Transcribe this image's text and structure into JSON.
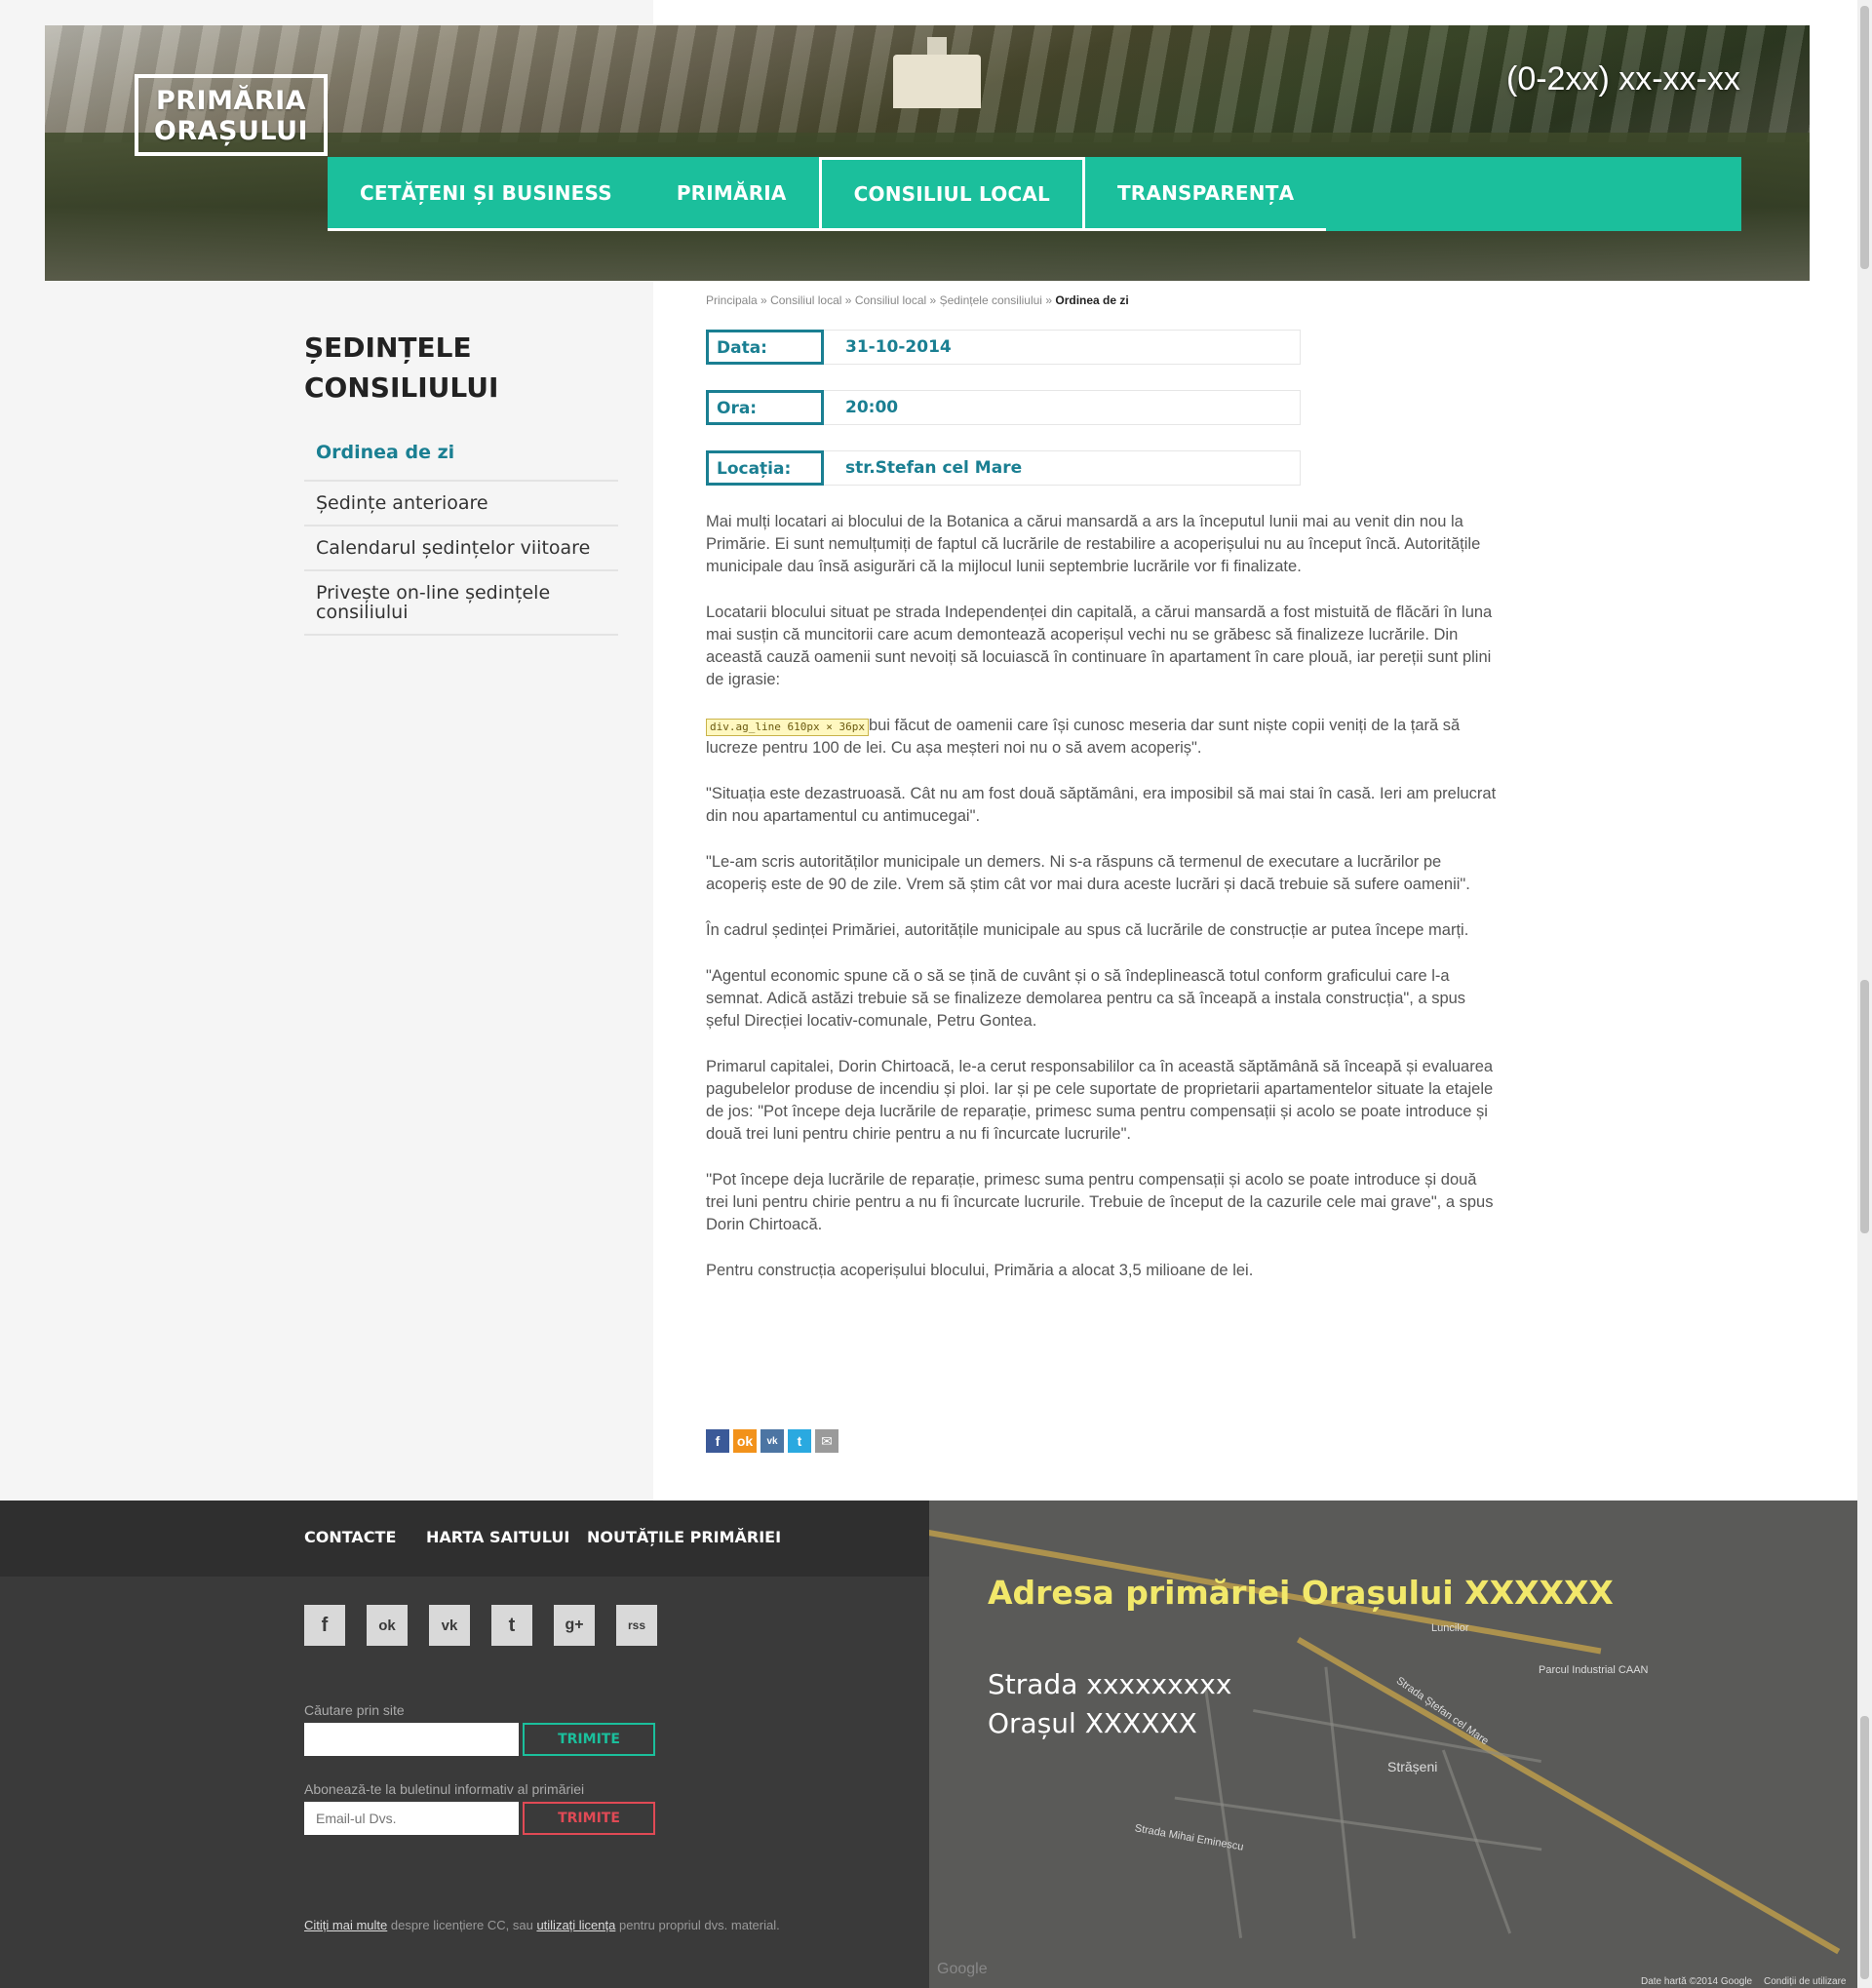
{
  "header": {
    "logo_line1": "PRIMĂRIA",
    "logo_line2": "ORAȘULUI",
    "phone": "(0-2xx) xx-xx-xx",
    "nav": [
      {
        "label": "CETĂȚENI ȘI BUSINESS"
      },
      {
        "label": "PRIMĂRIA"
      },
      {
        "label": "CONSILIUL LOCAL"
      },
      {
        "label": "TRANSPARENȚA"
      }
    ]
  },
  "breadcrumb": {
    "items": [
      "Principala",
      "Consiliul local",
      "Consiliul local",
      "Ședințele consiliului"
    ],
    "separator": "»",
    "current": "Ordinea de zi"
  },
  "sidebar": {
    "title_line1": "ȘEDINȚELE",
    "title_line2": "CONSILIULUI",
    "items": [
      {
        "label": "Ordinea de zi"
      },
      {
        "label": "Ședințe anterioare"
      },
      {
        "label": "Calendarul ședințelor viitoare"
      },
      {
        "label": "Privește on-line ședințele consiliului"
      }
    ]
  },
  "meeting": {
    "date_label": "Data:",
    "date_value": "31-10-2014",
    "time_label": "Ora:",
    "time_value": "20:00",
    "location_label": "Locația:",
    "location_value": "str.Stefan cel Mare"
  },
  "article": {
    "paragraphs": [
      "Mai mulți locatari ai blocului de la Botanica a cărui mansardă a ars la începutul lunii mai au venit din nou la Primărie. Ei sunt nemulțumiți de faptul că lucrările de restabilire a acoperișului nu au început încă. Autoritățile municipale dau însă asigurări că la mijlocul lunii septembrie lucrările vor fi finalizate.",
      "Locatarii blocului situat pe strada Independenței din capitală, a cărui mansardă a fost mistuită de flăcări în luna mai susțin că muncitorii care acum demontează acoperișul vechi nu se grăbesc să finalizeze lucrările. Din această cauză oamenii sunt nevoiți să locuiască în continuare în apartament în care plouă, iar pereții sunt plini de igrasie:",
      "bui făcut de oamenii care își cunosc meseria dar sunt niște copii veniți de la țară să lucreze pentru 100 de lei. Cu așa meșteri noi nu o să avem acoperiș\".",
      "\"Situația este dezastruoasă. Cât nu am fost două săptămâni, era imposibil să mai stai în casă. Ieri am prelucrat din nou apartamentul cu antimucegai\".",
      "\"Le-am scris autorităților municipale un demers. Ni s-a răspuns că termenul de executare a lucrărilor pe acoperiș este de 90 de zile. Vrem să știm cât vor mai dura aceste lucrări și dacă trebuie să sufere oamenii\".",
      "În cadrul ședinței Primăriei, autoritățile municipale au spus că lucrările de construcție ar putea începe marți.",
      "\"Agentul economic spune că o să se țină de cuvânt și o să îndeplinească totul conform graficului care l-a semnat. Adică astăzi trebuie să se finalizeze demolarea pentru ca să înceapă a instala construcția\", a spus șeful Direcției locativ-comunale, Petru Gontea.",
      "Primarul capitalei, Dorin Chirtoacă, le-a cerut responsabililor ca în această săptămână să înceapă și evaluarea pagubelelor produse de incendiu și ploi. Iar și pe cele suportate de proprietarii apartamentelor situate la etajele de jos: \"Pot începe deja lucrările de reparație, primesc suma pentru compensații și acolo se poate introduce și două trei luni pentru chirie pentru a nu fi încurcate lucrurile\".",
      "''Pot începe deja lucrările de reparație, primesc suma pentru compensații și acolo se poate introduce și două trei luni pentru chirie pentru a nu fi încurcate lucrurile. Trebuie de început de la cazurile cele mai grave\", a spus Dorin Chirtoacă.",
      "Pentru construcția acoperișului blocului, Primăria a alocat 3,5 milioane de lei."
    ],
    "tooltip": "div.ag_line 610px × 36px"
  },
  "share": {
    "icons": [
      "f",
      "ok",
      "vk",
      "t",
      "✉"
    ],
    "colors": [
      "#3b5998",
      "#f2921b",
      "#4c75a3",
      "#2aa9e0",
      "#9a9a9a"
    ]
  },
  "footer": {
    "nav": [
      "CONTACTE",
      "HARTA SAITULUI",
      "NOUTĂȚILE PRIMĂRIEI"
    ],
    "social": [
      "f",
      "ok",
      "vk",
      "t",
      "g+",
      "rss"
    ],
    "search_label": "Căutare prin site",
    "search_placeholder": "",
    "search_button": "TRIMITE",
    "subscribe_label": "Abonează-te la buletinul informativ al primăriei",
    "subscribe_placeholder": "Email-ul Dvs.",
    "subscribe_button": "TRIMITE",
    "license_link1": "Citiți mai multe",
    "license_text1": " despre licențiere CC, sau ",
    "license_link2": "utilizați licența",
    "license_text2": " pentru propriul dvs. material."
  },
  "map": {
    "title": "Adresa primăriei Orașului XXXXXX",
    "line1": "Strada xxxxxxxxx",
    "line2": "Orașul XXXXXX",
    "labels": [
      "Parcul Industrial CAAN",
      "Strada Ștefan cel Mare",
      "Strășeni",
      "Strada Mihai Eminescu",
      "Luncilor"
    ],
    "footer_left": "Google",
    "footer_right1": "Date hartă ©2014 Google",
    "footer_right2": "Condiții de utilizare"
  },
  "colors": {
    "accent": "#1bbf9c",
    "link": "#1a7f92",
    "footer_bg": "#3a3a3a",
    "map_title": "#f2e86a",
    "danger": "#e04a55"
  }
}
